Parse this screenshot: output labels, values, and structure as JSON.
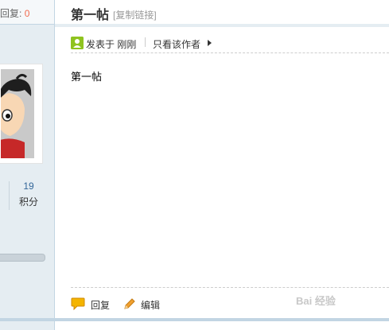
{
  "sidebar": {
    "reply_prefix": "回复:",
    "reply_count": "0",
    "stats": {
      "value": "19",
      "label": "积分"
    }
  },
  "post": {
    "title": "第一帖",
    "copy_link": "[复制链接]",
    "posted_at": "发表于 刚刚",
    "only_author": "只看该作者",
    "body": "第一帖"
  },
  "actions": {
    "reply": "回复",
    "edit": "编辑"
  },
  "colors": {
    "accent_link": "#336699",
    "reply_count": "#f26c4f",
    "sidebar_bg": "#e5edf2",
    "user_icon": "#8fc31f",
    "reply_icon": "#f4b400",
    "edit_icon": "#f0a030"
  },
  "icons": {
    "meta_user": "user-icon",
    "meta_arrow": "triangle-right-icon",
    "reply": "speech-bubble-icon",
    "edit": "pencil-icon",
    "avatar": "cartoon-avatar"
  },
  "watermark": "Bai 经验"
}
